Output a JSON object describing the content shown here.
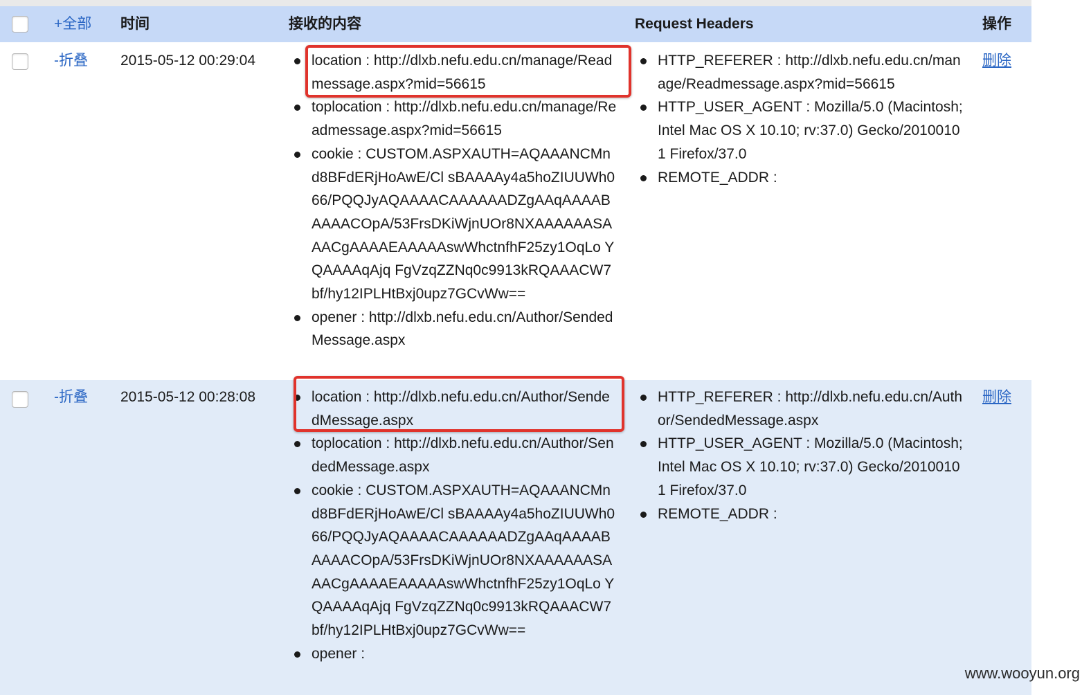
{
  "header": {
    "toggle_all": "+全部",
    "time": "时间",
    "content": "接收的内容",
    "request_headers": "Request Headers",
    "operation": "操作"
  },
  "rows": [
    {
      "toggle": "-折叠",
      "time": "2015-05-12 00:29:04",
      "content": [
        "location : http://dlxb.nefu.edu.cn/manage/Readmessage.aspx?mid=56615",
        "toplocation : http://dlxb.nefu.edu.cn/manage/Readmessage.aspx?mid=56615",
        "cookie : CUSTOM.ASPXAUTH=AQAAANCMnd8BFdERjHoAwE/Cl sBAAAAy4a5hoZIUUWh066/PQQJyAQAAAACAAAAAADZgAAqAAAABAAAACOpA/53FrsDKiWjnUOr8NXAAAAAASAAACgAAAAEAAAAAswWhctnfhF25zy1OqLo YQAAAAqAjq FgVzqZZNq0c9913kRQAAACW7bf/hy12IPLHtBxj0upz7GCvWw==",
        "opener : http://dlxb.nefu.edu.cn/Author/SendedMessage.aspx"
      ],
      "headers": [
        "HTTP_REFERER : http://dlxb.nefu.edu.cn/manage/Readmessage.aspx?mid=56615",
        "HTTP_USER_AGENT : Mozilla/5.0 (Macintosh; Intel Mac OS X 10.10; rv:37.0) Gecko/20100101 Firefox/37.0",
        "REMOTE_ADDR :"
      ],
      "delete": "删除"
    },
    {
      "toggle": "-折叠",
      "time": "2015-05-12 00:28:08",
      "content": [
        "location : http://dlxb.nefu.edu.cn/Author/SendedMessage.aspx",
        "toplocation : http://dlxb.nefu.edu.cn/Author/SendedMessage.aspx",
        "cookie : CUSTOM.ASPXAUTH=AQAAANCMnd8BFdERjHoAwE/Cl sBAAAAy4a5hoZIUUWh066/PQQJyAQAAAACAAAAAADZgAAqAAAABAAAACOpA/53FrsDKiWjnUOr8NXAAAAAASAAACgAAAAEAAAAAswWhctnfhF25zy1OqLo YQAAAAqAjq FgVzqZZNq0c9913kRQAAACW7bf/hy12IPLHtBxj0upz7GCvWw==",
        "opener :"
      ],
      "headers": [
        "HTTP_REFERER : http://dlxb.nefu.edu.cn/Author/SendedMessage.aspx",
        "HTTP_USER_AGENT : Mozilla/5.0 (Macintosh; Intel Mac OS X 10.10; rv:37.0) Gecko/20100101 Firefox/37.0",
        "REMOTE_ADDR :"
      ],
      "delete": "删除"
    }
  ],
  "watermark": "www.wooyun.org",
  "colors": {
    "header_bg": "#c6d9f7",
    "alt_row_bg": "#e1ebf8",
    "link": "#2a66c4",
    "highlight": "#e0332c"
  }
}
